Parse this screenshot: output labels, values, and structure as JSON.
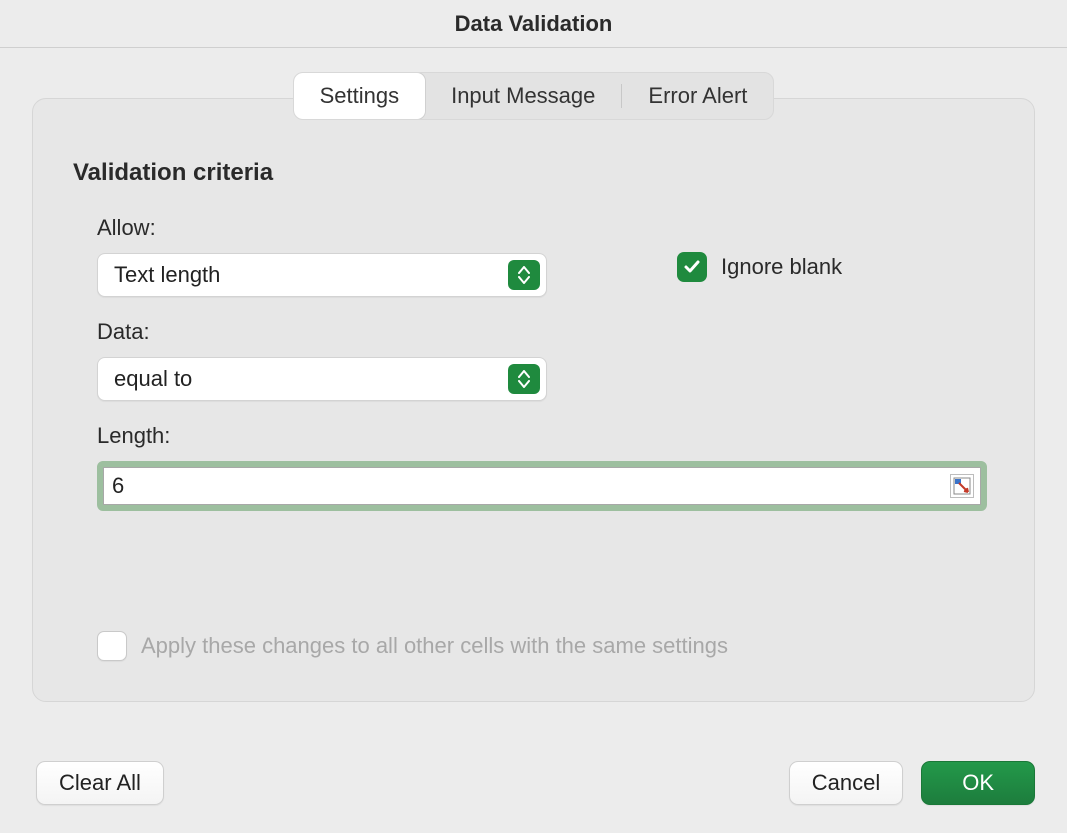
{
  "dialog": {
    "title": "Data Validation"
  },
  "tabs": {
    "settings": "Settings",
    "input_message": "Input Message",
    "error_alert": "Error Alert",
    "active": "settings"
  },
  "criteria": {
    "section_title": "Validation criteria",
    "allow_label": "Allow:",
    "allow_value": "Text length",
    "data_label": "Data:",
    "data_value": "equal to",
    "length_label": "Length:",
    "length_value": "6",
    "ignore_blank_label": "Ignore blank",
    "ignore_blank_checked": true,
    "apply_label": "Apply these changes to all other cells with the same settings",
    "apply_checked": false,
    "apply_enabled": false
  },
  "buttons": {
    "clear_all": "Clear All",
    "cancel": "Cancel",
    "ok": "OK"
  },
  "icons": {
    "stepper": "up-down-chevrons",
    "check": "checkmark",
    "range_picker": "cell-range-picker"
  }
}
